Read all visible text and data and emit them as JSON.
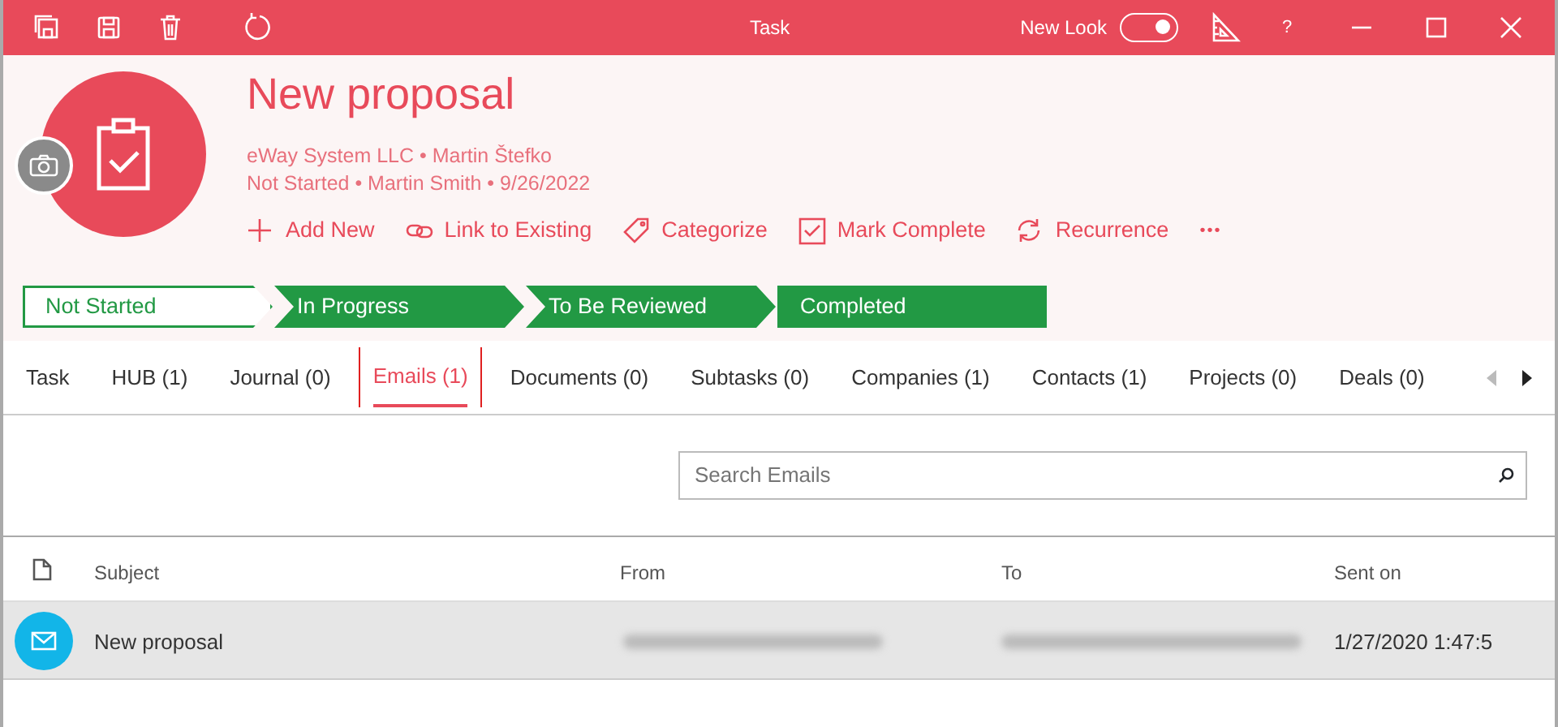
{
  "window": {
    "title": "Task",
    "new_look": {
      "label": "New Look",
      "on": true
    },
    "help": "?"
  },
  "header": {
    "title": "New proposal",
    "line_1": "eWay System LLC • Martin Štefko",
    "line_2": "Not Started • Martin Smith • 9/26/2022"
  },
  "actions": [
    {
      "kind": "add",
      "label": "Add New"
    },
    {
      "kind": "link",
      "label": "Link to Existing"
    },
    {
      "kind": "tag",
      "label": "Categorize"
    },
    {
      "kind": "check",
      "label": "Mark Complete"
    },
    {
      "kind": "repeat",
      "label": "Recurrence"
    },
    {
      "kind": "more",
      "label": "•••"
    }
  ],
  "stages": [
    {
      "label": "Not Started",
      "selected": true
    },
    {
      "label": "In Progress",
      "selected": false
    },
    {
      "label": "To Be Reviewed",
      "selected": false
    },
    {
      "label": "Completed",
      "selected": false
    }
  ],
  "tabs": [
    {
      "label": "Task",
      "selected": false
    },
    {
      "label": "HUB (1)",
      "selected": false
    },
    {
      "label": "Journal (0)",
      "selected": false
    },
    {
      "label": "Emails (1)",
      "selected": true
    },
    {
      "label": "Documents (0)",
      "selected": false
    },
    {
      "label": "Subtasks (0)",
      "selected": false
    },
    {
      "label": "Companies (1)",
      "selected": false
    },
    {
      "label": "Contacts (1)",
      "selected": false
    },
    {
      "label": "Projects (0)",
      "selected": false
    },
    {
      "label": "Deals (0)",
      "selected": false
    }
  ],
  "search": {
    "placeholder": "Search Emails"
  },
  "table": {
    "columns": [
      "Subject",
      "From",
      "To",
      "Sent on"
    ],
    "rows": [
      {
        "subject": "New proposal",
        "sent_on": "1/27/2020 1:47:5",
        "selected": true
      }
    ]
  }
}
